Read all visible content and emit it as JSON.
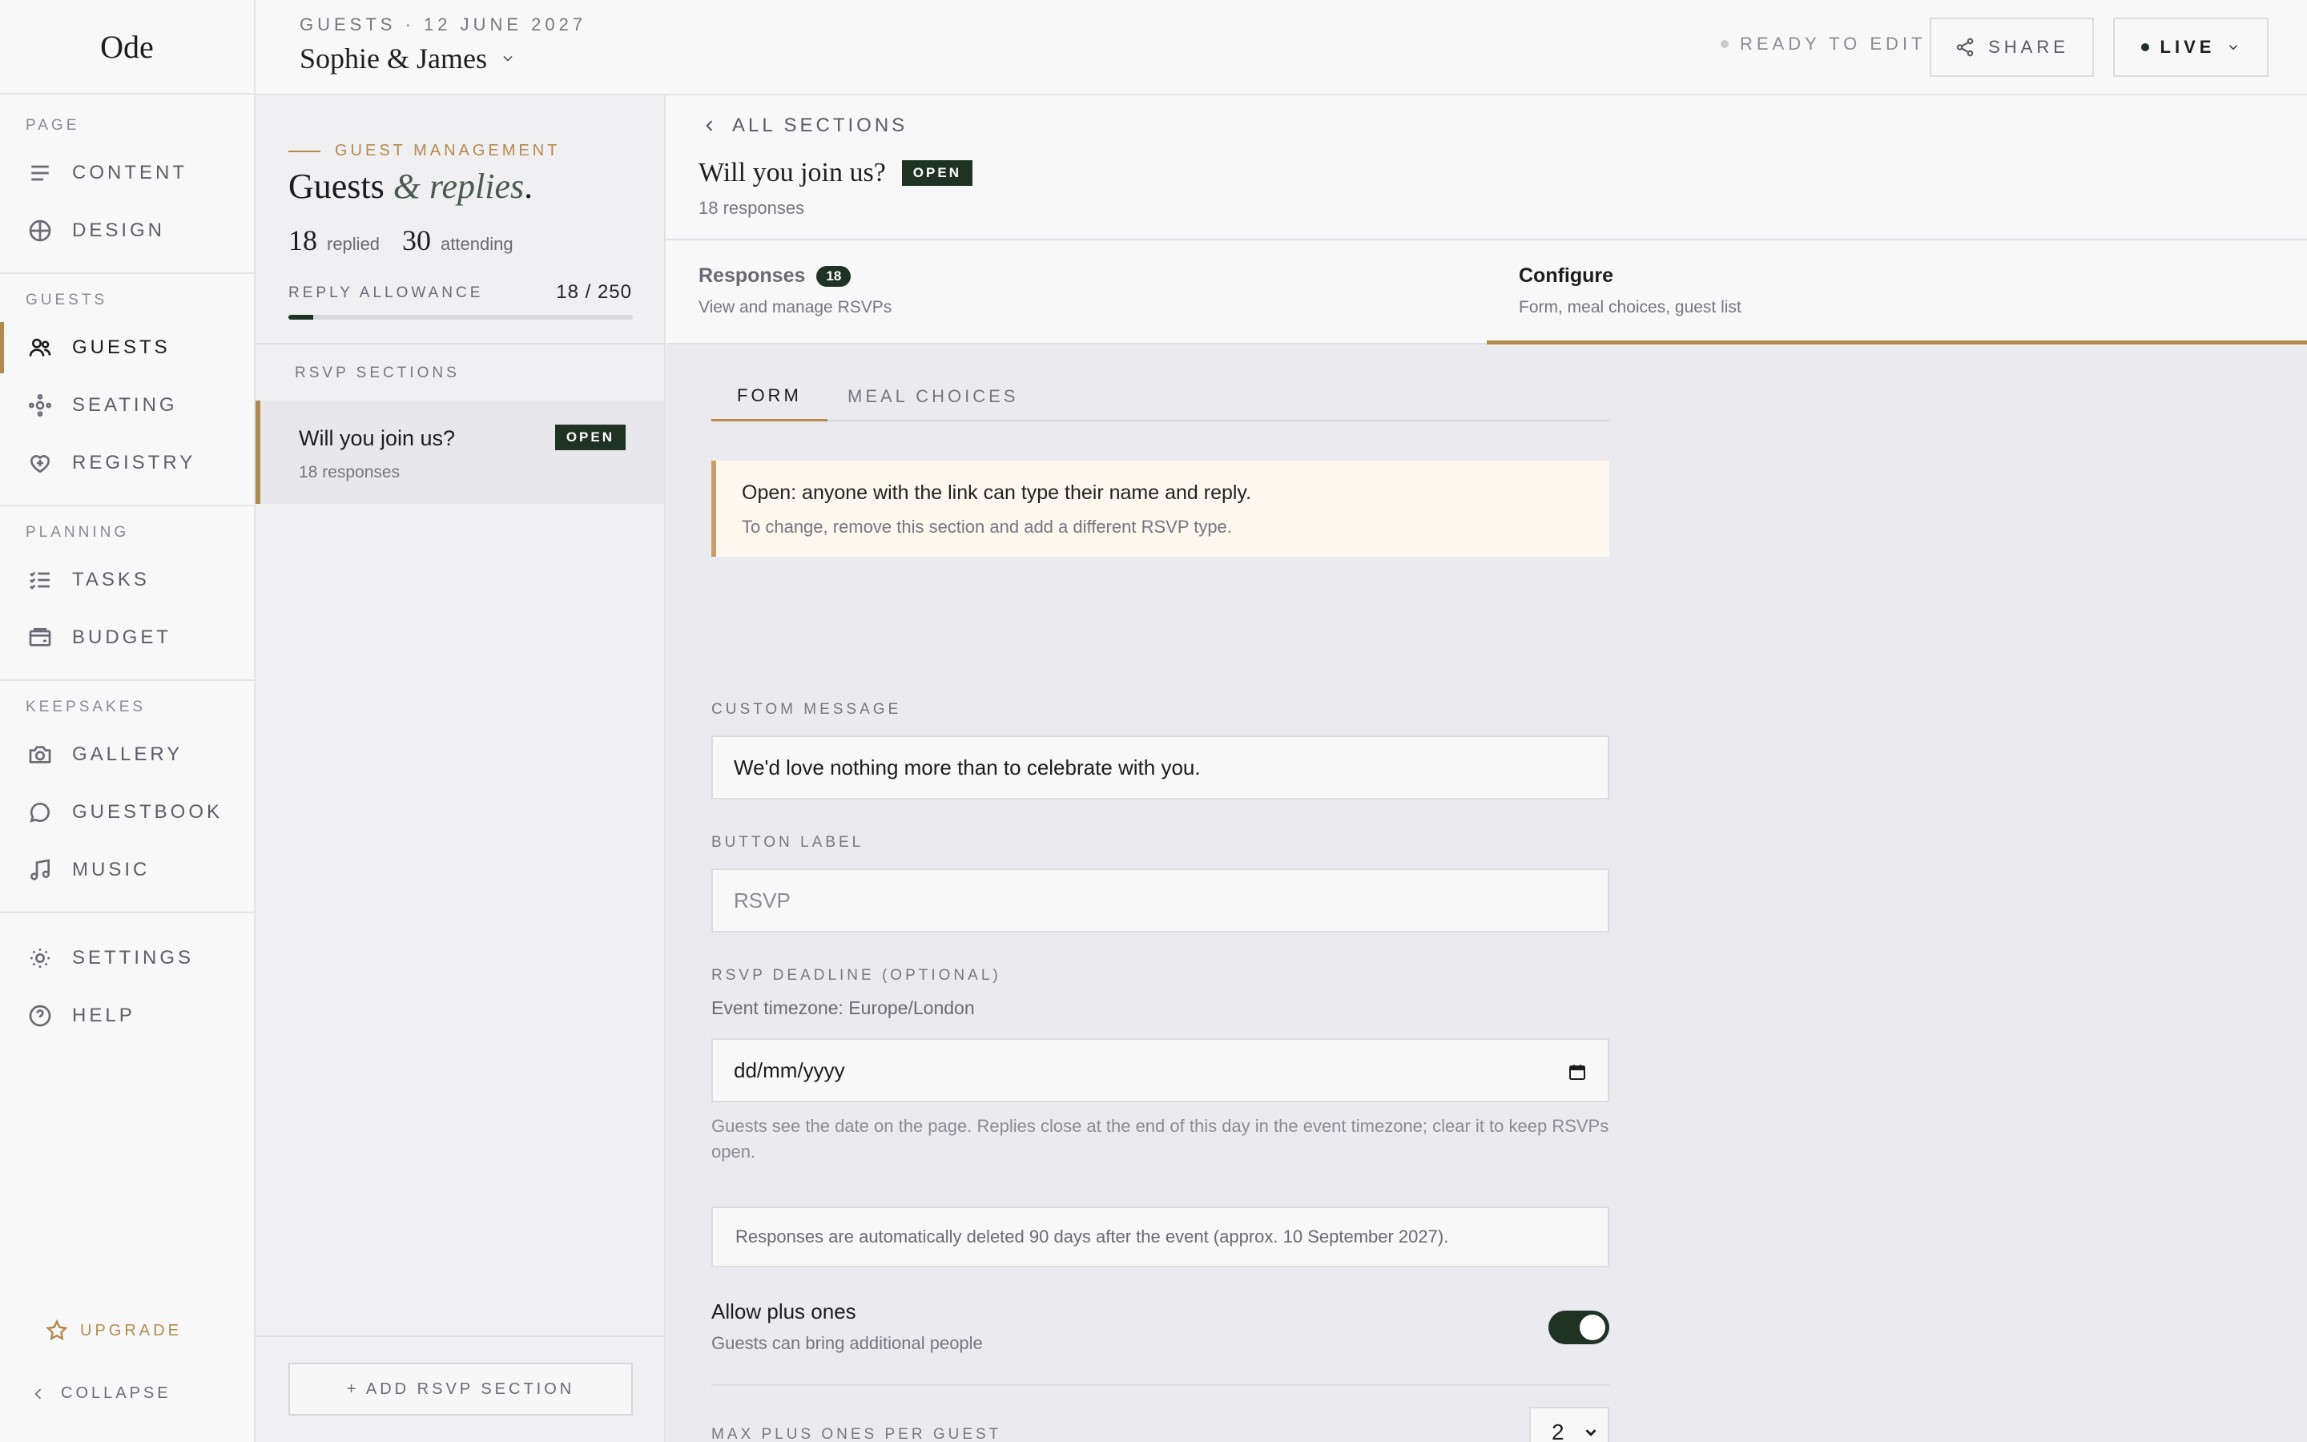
{
  "app": {
    "logo": "Ode"
  },
  "sidebar": {
    "groups": [
      {
        "label": "Page"
      },
      {
        "label": "Guests"
      },
      {
        "label": "Planning"
      },
      {
        "label": "Keepsakes"
      }
    ],
    "items": [
      {
        "label": "Content",
        "icon": "lines-icon"
      },
      {
        "label": "Design",
        "icon": "globe-icon"
      },
      {
        "label": "Guests",
        "icon": "users-icon",
        "active": true
      },
      {
        "label": "Seating",
        "icon": "seating-icon"
      },
      {
        "label": "Registry",
        "icon": "heart-gift-icon"
      },
      {
        "label": "Tasks",
        "icon": "checklist-icon"
      },
      {
        "label": "Budget",
        "icon": "wallet-icon"
      },
      {
        "label": "Gallery",
        "icon": "camera-icon"
      },
      {
        "label": "Guestbook",
        "icon": "chat-icon"
      },
      {
        "label": "Music",
        "icon": "music-icon"
      },
      {
        "label": "Settings",
        "icon": "sun-icon"
      },
      {
        "label": "Help",
        "icon": "help-icon"
      }
    ],
    "upgrade": "Upgrade",
    "collapse": "Collapse"
  },
  "header": {
    "crumb": "Guests · 12 June 2027",
    "couple": "Sophie & James",
    "status": "Ready to edit",
    "share": "Share",
    "live": "Live"
  },
  "guest_panel": {
    "kicker": "Guest Management",
    "title_a": "Guests ",
    "title_amp": "&",
    "title_b": " replies",
    "title_end": ".",
    "replied_num": "18",
    "replied_label": "replied",
    "attending_num": "30",
    "attending_label": "attending",
    "allowance_label": "Reply allowance",
    "allowance_value": "18 / 250",
    "allowance_fraction": 0.072,
    "sections_label": "RSVP Sections",
    "section": {
      "title": "Will you join us?",
      "badge": "Open",
      "sub": "18 responses"
    },
    "add_button": "+ Add RSVP Section"
  },
  "main": {
    "back": "All sections",
    "title": "Will you join us?",
    "badge": "Open",
    "sub": "18 responses",
    "tabs": [
      {
        "title": "Responses",
        "count": "18",
        "sub": "View and manage RSVPs"
      },
      {
        "title": "Configure",
        "sub": "Form, meal choices, guest list",
        "active": true
      }
    ],
    "subtabs": [
      "Form",
      "Meal choices"
    ],
    "notice": {
      "line1": "Open: anyone with the link can type their name and reply.",
      "line2": "To change, remove this section and add a different RSVP type."
    },
    "custom_message_label": "Custom message",
    "custom_message_value": "We'd love nothing more than to celebrate with you.",
    "button_label_label": "Button label",
    "button_label_placeholder": "RSVP",
    "deadline_label": "RSVP deadline (optional)",
    "timezone": "Event timezone: Europe/London",
    "date_placeholder": "dd/mm/yyyy",
    "deadline_help": "Guests see the date on the page. Replies close at the end of this day in the event timezone; clear it to keep RSVPs open.",
    "retention_info": "Responses are automatically deleted 90 days after the event (approx. 10 September 2027).",
    "plus_ones_title": "Allow plus ones",
    "plus_ones_sub": "Guests can bring additional people",
    "plus_ones_enabled": true,
    "max_plus_label": "Max plus ones per guest",
    "max_plus_value": "2"
  },
  "colors": {
    "accent": "#b38a4a",
    "dark_green": "#1f3325"
  }
}
